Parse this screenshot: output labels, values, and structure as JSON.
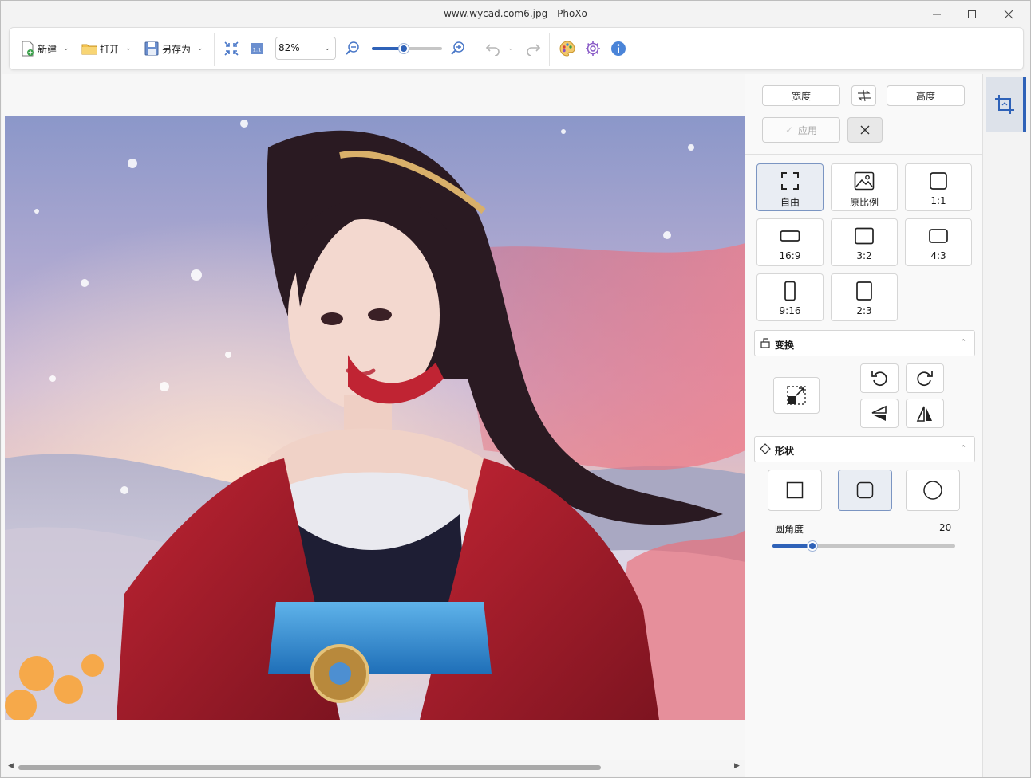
{
  "window": {
    "title": "www.wycad.com6.jpg - PhoXo"
  },
  "toolbar": {
    "new_label": "新建",
    "open_label": "打开",
    "saveas_label": "另存为",
    "zoom_value": "82%",
    "zoom_slider_fraction": 0.45
  },
  "crop_panel": {
    "width_label": "宽度",
    "height_label": "高度",
    "apply_label": "应用",
    "ratios": [
      {
        "label": "自由",
        "icon": "free-crop-icon"
      },
      {
        "label": "原比例",
        "icon": "image-icon"
      },
      {
        "label": "1:1",
        "icon": "square-ratio-icon"
      },
      {
        "label": "16:9",
        "icon": "ratio-16-9-icon"
      },
      {
        "label": "3:2",
        "icon": "ratio-3-2-icon"
      },
      {
        "label": "4:3",
        "icon": "ratio-4-3-icon"
      },
      {
        "label": "9:16",
        "icon": "ratio-9-16-icon"
      },
      {
        "label": "2:3",
        "icon": "ratio-2-3-icon"
      }
    ],
    "selected_ratio": "自由"
  },
  "transform": {
    "title": "变换"
  },
  "shape": {
    "title": "形状",
    "corner_label": "圆角度",
    "corner_value": "20",
    "corner_fraction": 0.22,
    "selected_shape": "rounded-square"
  },
  "colors": {
    "accent": "#2f62b8"
  }
}
